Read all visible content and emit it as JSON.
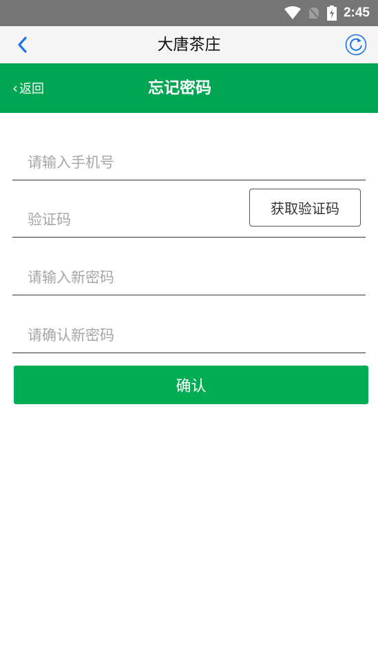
{
  "status_bar": {
    "time": "2:45",
    "icons": [
      "wifi-icon",
      "no-sim-icon",
      "battery-charging-icon"
    ]
  },
  "app_bar": {
    "title": "大唐茶庄",
    "back_icon": "chevron-left-icon",
    "refresh_icon": "refresh-icon",
    "accent_color": "#1a73e8"
  },
  "header": {
    "back_label": "返回",
    "title": "忘记密码",
    "color": "#00a651"
  },
  "form": {
    "phone_placeholder": "请输入手机号",
    "code_placeholder": "验证码",
    "get_code_label": "获取验证码",
    "new_password_placeholder": "请输入新密码",
    "confirm_password_placeholder": "请确认新密码",
    "submit_label": "确认"
  }
}
